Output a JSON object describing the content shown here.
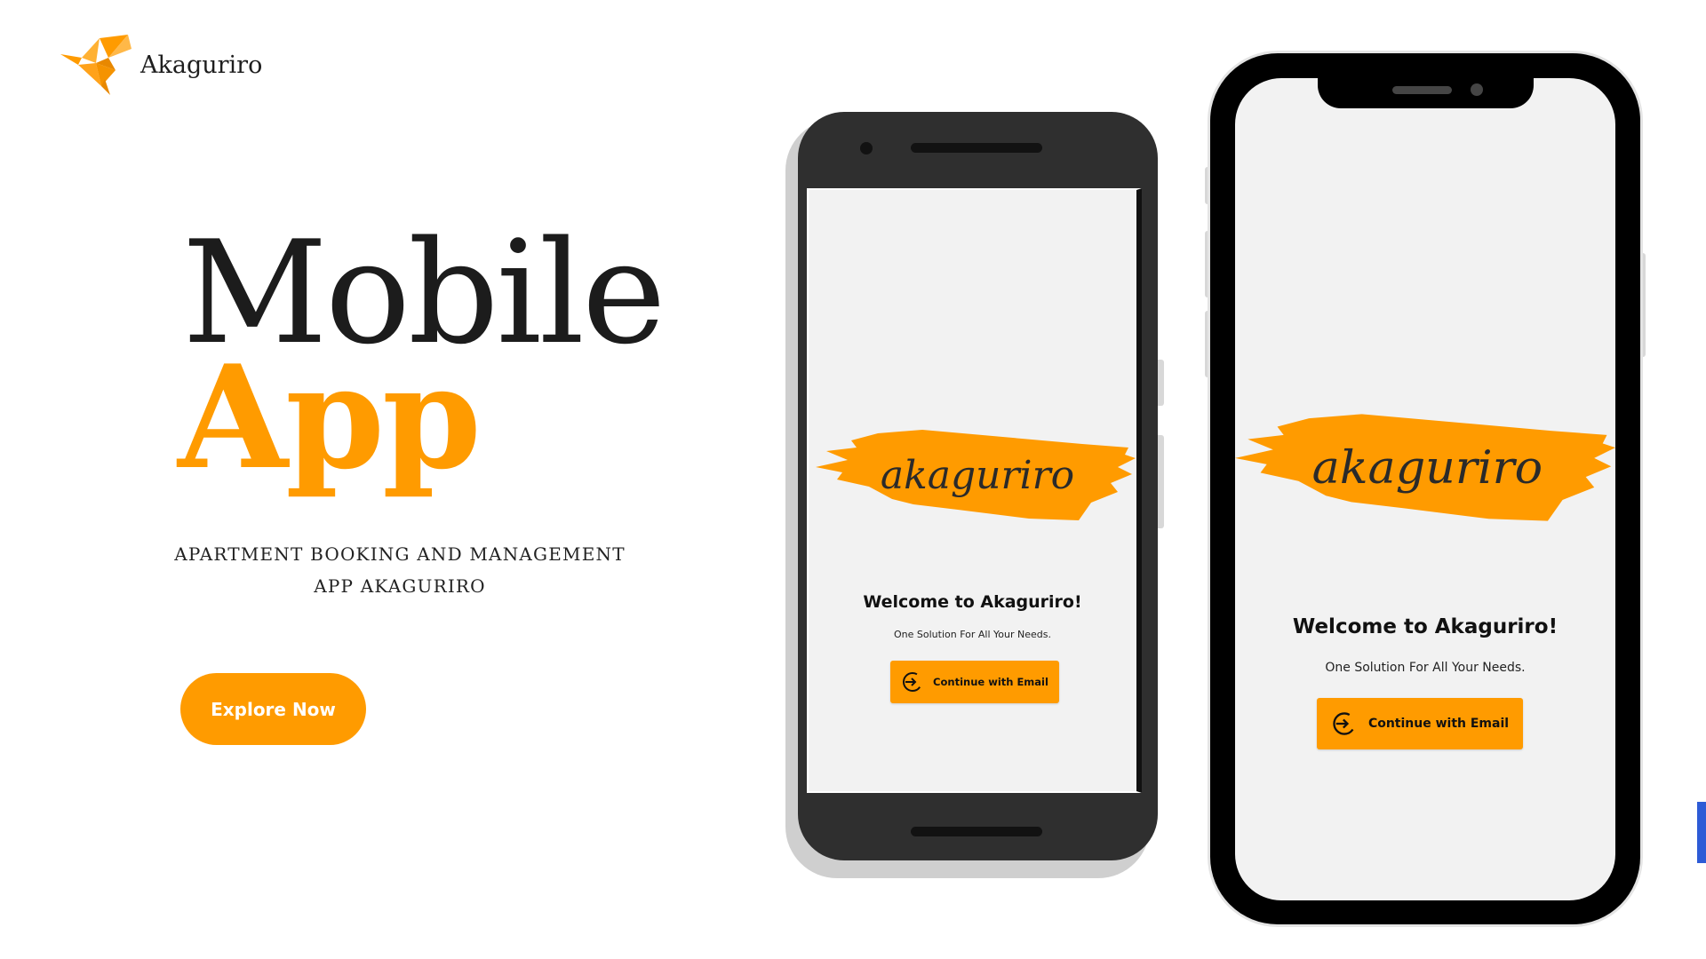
{
  "brand": {
    "name": "Akaguriro",
    "logo_icon": "origami-bird-icon",
    "accent": "#ff9b00"
  },
  "hero": {
    "line1": "Mobile",
    "line2": "App",
    "subtitle_line1": "APARTMENT BOOKING AND MANAGEMENT",
    "subtitle_line2": "APP AKAGURIRO",
    "cta_label": "Explore Now"
  },
  "phone_screen": {
    "logo_text": "akaguriro",
    "welcome": "Welcome to Akaguriro!",
    "tagline": "One Solution For All Your Needs.",
    "button_label": "Continue with Email",
    "button_icon": "login-arrow-icon"
  },
  "colors": {
    "accent": "#ff9b00",
    "text_dark": "#1c1c1c",
    "screen_bg": "#f2f2f2",
    "edge_accent": "#2d5bd6"
  }
}
